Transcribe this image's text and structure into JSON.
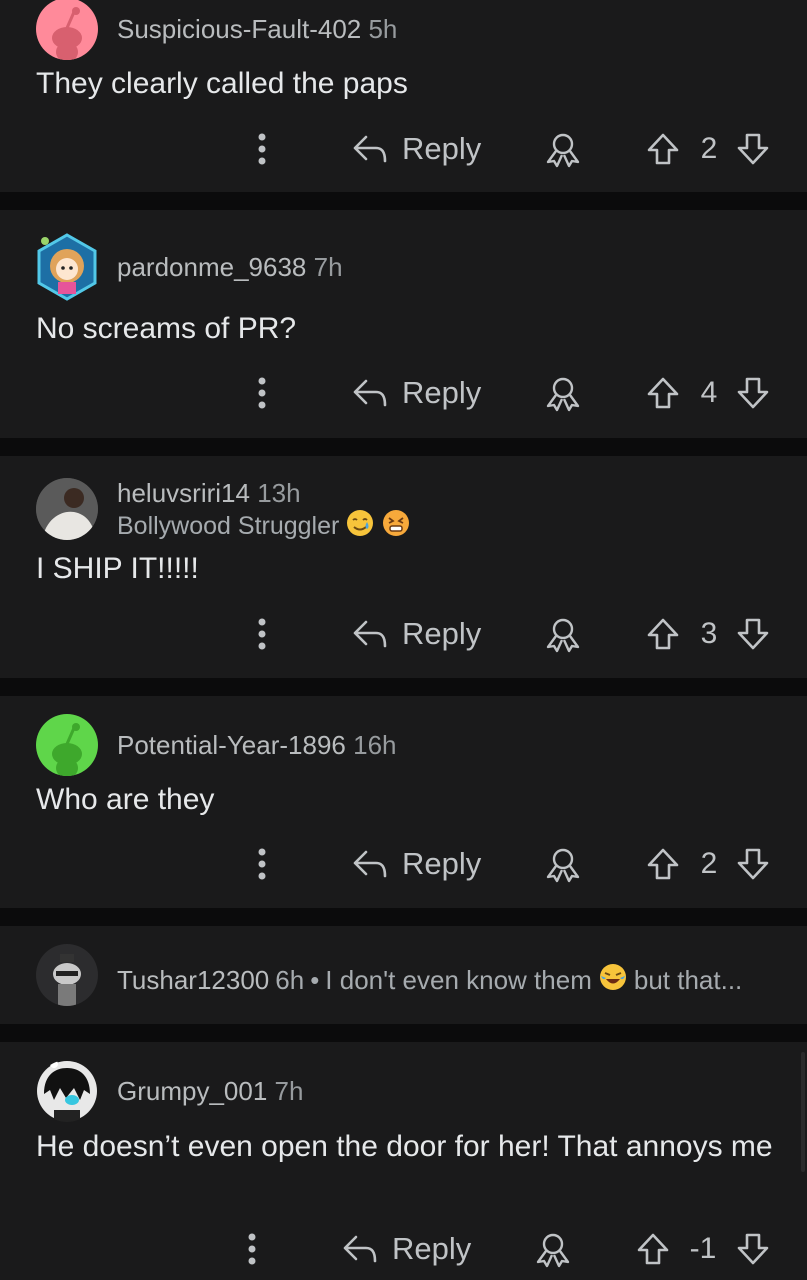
{
  "action_labels": {
    "reply": "Reply"
  },
  "comments": [
    {
      "username": "Suspicious-Fault-402",
      "time": "5h",
      "body": "They clearly called the paps",
      "score": "2",
      "avatar_color": "#ff8a9a"
    },
    {
      "username": "pardonme_9638",
      "time": "7h",
      "body": "No screams of PR?",
      "score": "4"
    },
    {
      "username": "heluvsriri14",
      "time": "13h",
      "flair": "Bollywood Struggler",
      "body": "I SHIP IT!!!!!",
      "score": "3"
    },
    {
      "username": "Potential-Year-1896",
      "time": "16h",
      "body": "Who are they",
      "score": "2",
      "avatar_color": "#5fd64a"
    },
    {
      "username": "Tushar12300",
      "time": "6h",
      "separator": "•",
      "preview_start": "I don't even know them",
      "preview_end": "but that...",
      "collapsed": true
    },
    {
      "username": "Grumpy_001",
      "time": "7h",
      "body": "He doesn’t even open the door for her! That annoys me",
      "score": "-1"
    }
  ],
  "colors": {
    "page_bg": "#0b0b0c",
    "card_bg": "#1a1a1b",
    "text": "#e6e8ea",
    "muted": "#a6abaf"
  }
}
